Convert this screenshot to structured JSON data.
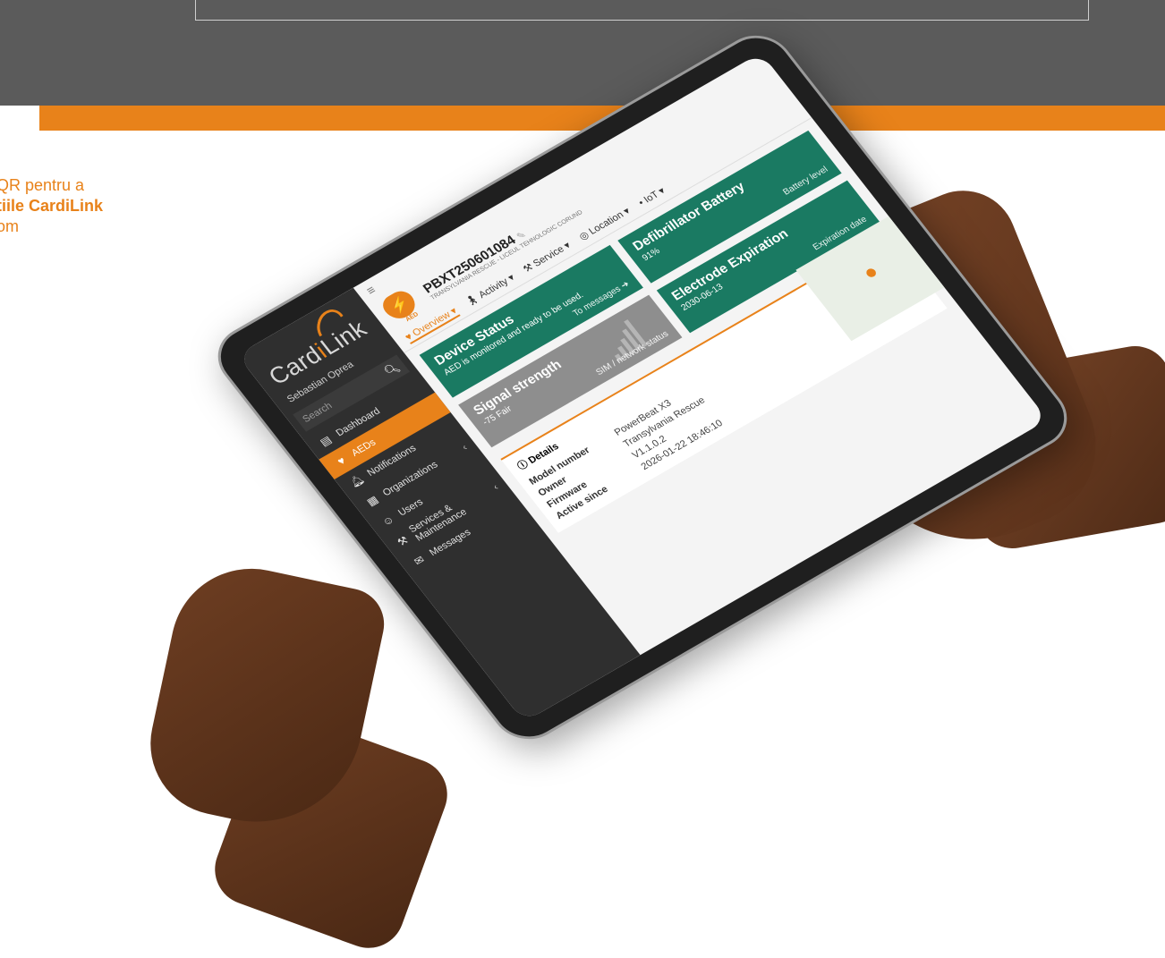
{
  "promo": {
    "line1": "QR pentru a",
    "line2": "tiile CardiLink",
    "line3": "om"
  },
  "sidebar": {
    "brand_prefix": "Card",
    "brand_accent": "i",
    "brand_suffix": "Link",
    "user_name": "Sebastian Oprea",
    "search_placeholder": "Search",
    "items": [
      {
        "label": "Dashboard",
        "icon": "chart-icon"
      },
      {
        "label": "AEDs",
        "icon": "heart-icon",
        "active": true
      },
      {
        "label": "Notifications",
        "icon": "bell-icon"
      },
      {
        "label": "Organizations",
        "icon": "building-icon"
      },
      {
        "label": "Users",
        "icon": "user-icon"
      },
      {
        "label": "Services & Maintenance",
        "icon": "tools-icon"
      },
      {
        "label": "Messages",
        "icon": "mail-icon"
      }
    ]
  },
  "device": {
    "badge_text": "AED",
    "id": "PBXT250601084",
    "organization": "TRANSYLVANIA RESCUE - LICEUL TEHNOLOGIC CORUND"
  },
  "tabs": [
    {
      "label": "Overview",
      "icon": "heart-icon",
      "active": true
    },
    {
      "label": "Activity",
      "icon": "person-icon"
    },
    {
      "label": "Service",
      "icon": "tools-icon"
    },
    {
      "label": "Location",
      "icon": "globe-icon"
    },
    {
      "label": "IoT",
      "icon": "signal-icon"
    }
  ],
  "cards": {
    "device_status": {
      "title": "Device Status",
      "text": "AED is monitored and ready to be used.",
      "link": "To messages"
    },
    "battery": {
      "title": "Defibrillator Battery",
      "value": "91%",
      "caption": "Battery level"
    },
    "electrode": {
      "title": "Electrode Expiration",
      "value": "2030-06-13",
      "caption": "Expiration date"
    },
    "signal": {
      "title": "Signal strength",
      "value": "-75 Fair",
      "caption": "SIM / network status"
    }
  },
  "details": {
    "heading": "Details",
    "rows": [
      {
        "key": "Model number",
        "value": "PowerBeat X3"
      },
      {
        "key": "Owner",
        "value": "Transylvania Rescue"
      },
      {
        "key": "Firmware",
        "value": "V1.1.0.2"
      },
      {
        "key": "Active since",
        "value": "2026-01-22 18:46:10"
      }
    ]
  },
  "colors": {
    "accent": "#e8821a",
    "card_green": "#1a7a62",
    "card_gray": "#8e8e8e",
    "sidebar_bg": "#2f2f2f"
  }
}
